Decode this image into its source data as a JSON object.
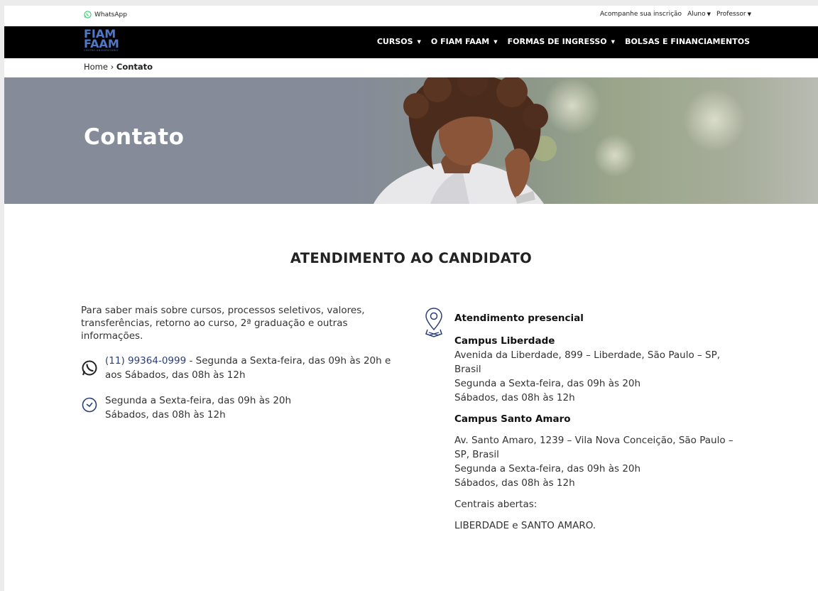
{
  "topbar": {
    "whatsapp_label": "WhatsApp",
    "links": [
      "Acompanhe sua inscrição",
      "Aluno",
      "Professor"
    ]
  },
  "logo": {
    "line1": "FIAM",
    "line2": "FAAM",
    "line3": "CENTRO UNIVERSITÁRIO"
  },
  "nav": {
    "items": [
      "CURSOS",
      "O FIAM FAAM",
      "FORMAS DE INGRESSO",
      "BOLSAS E FINANCIAMENTOS"
    ]
  },
  "breadcrumb": {
    "home": "Home",
    "separator": "›",
    "current": "Contato"
  },
  "hero": {
    "title": "Contato"
  },
  "section": {
    "title": "ATENDIMENTO AO CANDIDATO"
  },
  "left": {
    "intro": "Para saber mais sobre cursos, processos seletivos, valores, transferências, retorno ao curso, 2ª graduação e outras informações.",
    "phone": "(11) 99364-0999",
    "phone_hours": " - Segunda a Sexta-feira, das 09h às 20h e aos Sábados, das 08h às 12h",
    "hours_line1": "Segunda a Sexta-feira, das 09h às 20h",
    "hours_line2": "Sábados, das 08h às 12h"
  },
  "right": {
    "heading": "Atendimento presencial",
    "campus1": {
      "name": "Campus Liberdade",
      "address": "Avenida da Liberdade, 899 – Liberdade, São Paulo – SP, Brasil",
      "hours1": "Segunda a Sexta-feira, das 09h às 20h",
      "hours2": "Sábados, das 08h às 12h"
    },
    "campus2": {
      "name": "Campus Santo Amaro",
      "address": "Av. Santo Amaro, 1239 – Vila Nova Conceição, São Paulo – SP, Brasil",
      "hours1": "Segunda a Sexta-feira, das 09h às 20h",
      "hours2": "Sábados, das 08h às 12h"
    },
    "open_label": "Centrais abertas:",
    "open_value": "LIBERDADE e SANTO AMARO."
  },
  "colors": {
    "nav_bg": "#000000",
    "logo_blue": "#4f79c7",
    "hero_bg": "#858b99",
    "link_blue": "#2a3e7a",
    "whatsapp_green": "#25d366"
  }
}
